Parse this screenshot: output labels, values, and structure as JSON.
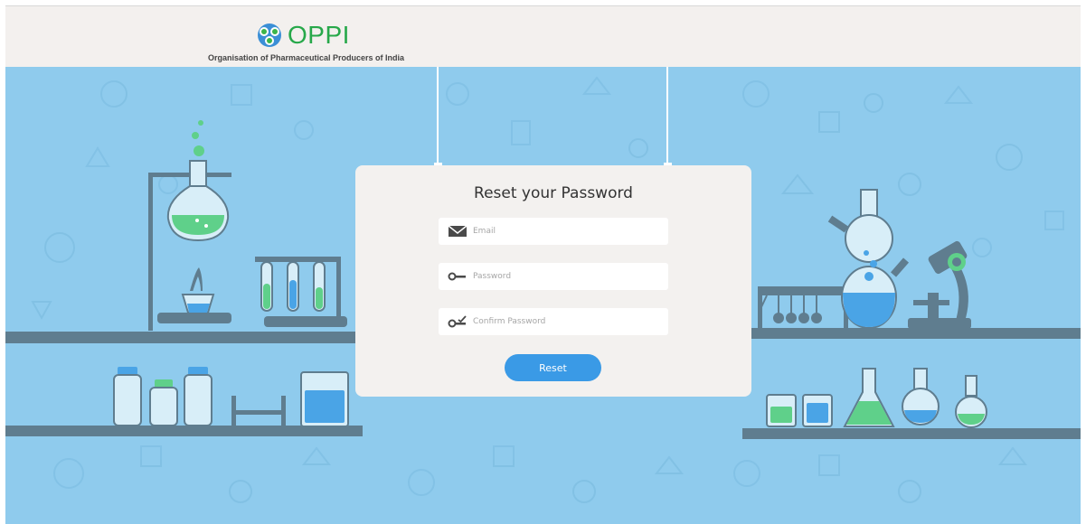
{
  "header": {
    "brand": "OPPI",
    "tagline": "Organisation of Pharmaceutical Producers of India"
  },
  "card": {
    "title": "Reset your Password",
    "email_placeholder": "Email",
    "password_placeholder": "Password",
    "confirm_placeholder": "Confirm Password",
    "reset_label": "Reset"
  },
  "colors": {
    "background": "#8fcbed",
    "header_bg": "#f3f0ee",
    "card_bg": "#f3f1ef",
    "button": "#3a9ae6",
    "brand_green": "#27a84a",
    "shelf": "#5f7d8f"
  },
  "icons": [
    "mail-icon",
    "key-icon",
    "key-check-icon",
    "oppi-logo"
  ]
}
